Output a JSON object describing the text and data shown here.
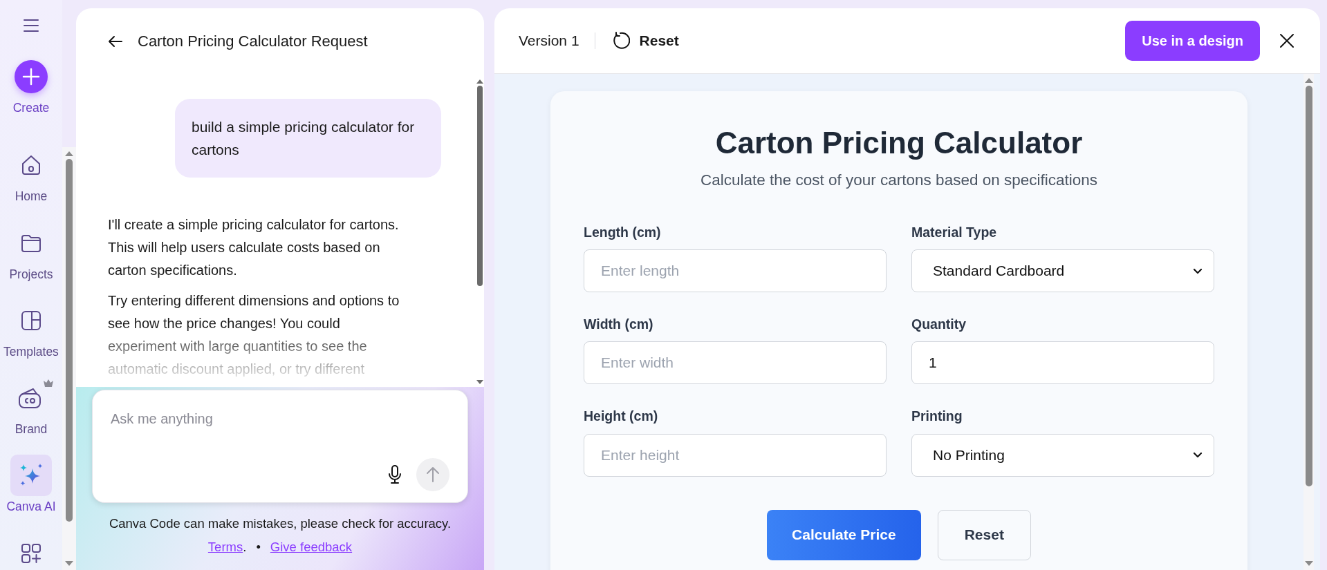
{
  "rail": {
    "items": [
      {
        "kind": "create",
        "label": "Create",
        "selected": false
      },
      {
        "kind": "home",
        "label": "Home",
        "selected": false
      },
      {
        "kind": "projects",
        "label": "Projects",
        "selected": false
      },
      {
        "kind": "templates",
        "label": "Templates",
        "selected": false
      },
      {
        "kind": "brand",
        "label": "Brand",
        "selected": false
      },
      {
        "kind": "ai",
        "label": "Canva AI",
        "selected": true
      },
      {
        "kind": "apps",
        "selected": false
      }
    ]
  },
  "chat": {
    "title": "Carton Pricing Calculator Request",
    "messages": [
      {
        "kind": "user",
        "paragraphs": [
          "build a simple pricing calculator for cartons"
        ]
      },
      {
        "kind": "assistant",
        "paragraphs": [
          "I'll create a simple pricing calculator for cartons. This will help users calculate costs based on carton specifications.",
          "Try entering different dimensions and options to see how the price changes! You could experiment with large quantities to see the automatic discount applied, or try different"
        ]
      }
    ],
    "input": {
      "placeholder": "Ask me anything"
    },
    "disclaimer": "Canva Code can make mistakes, please check for accuracy.",
    "links": [
      {
        "text": "Terms",
        "suffix": "."
      },
      {
        "text": "Give feedback"
      }
    ],
    "separator": "•"
  },
  "toolbar": {
    "version": "Version 1",
    "reset": "Reset",
    "use_button": "Use in a design"
  },
  "calculator": {
    "title": "Carton Pricing Calculator",
    "subtitle": "Calculate the cost of your cartons based on specifications",
    "fields": [
      {
        "kind": "input",
        "label": "Length (cm)",
        "placeholder": "Enter length"
      },
      {
        "kind": "select",
        "label": "Material Type",
        "value": "Standard Cardboard"
      },
      {
        "kind": "input",
        "label": "Width (cm)",
        "placeholder": "Enter width"
      },
      {
        "kind": "input",
        "label": "Quantity",
        "value": "1"
      },
      {
        "kind": "input",
        "label": "Height (cm)",
        "placeholder": "Enter height"
      },
      {
        "kind": "select",
        "label": "Printing",
        "value": "No Printing"
      }
    ],
    "buttons": [
      {
        "kind": "primary",
        "label": "Calculate Price"
      },
      {
        "kind": "secondary",
        "label": "Reset"
      }
    ]
  }
}
